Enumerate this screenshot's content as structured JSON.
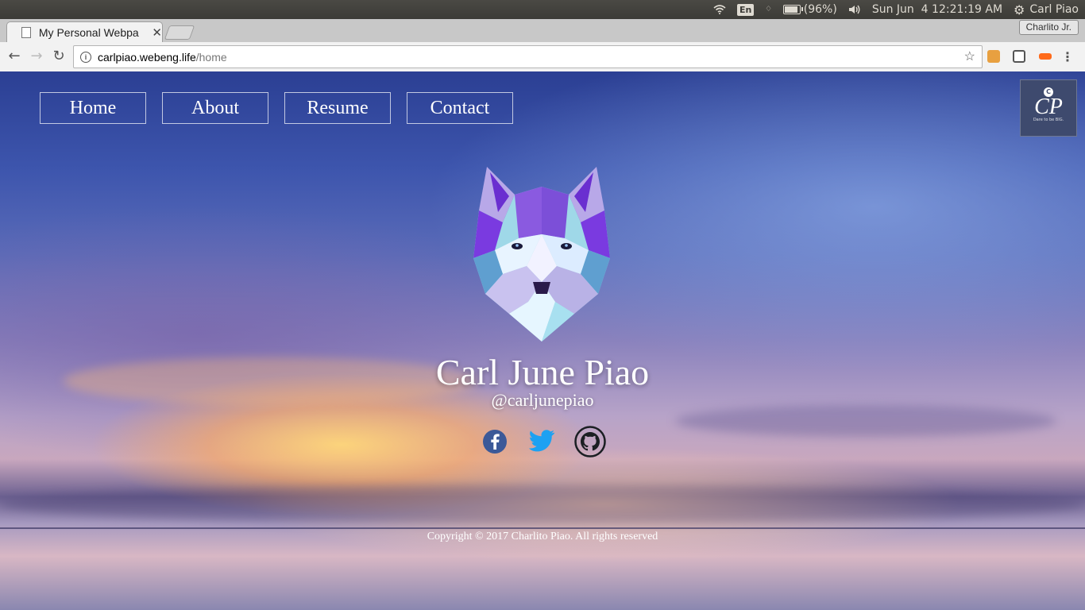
{
  "os_panel": {
    "lang": "En",
    "battery": "(96%)",
    "battery_level_percent": 96,
    "clock": "Sun Jun  4 12:21:19 AM",
    "user": "Carl Piao"
  },
  "browser": {
    "tab_title": "My Personal Webpa",
    "profile_name": "Charlito Jr.",
    "url_host": "carlpiao.webeng.life",
    "url_path": "/home"
  },
  "page": {
    "nav": [
      {
        "label": "Home"
      },
      {
        "label": "About"
      },
      {
        "label": "Resume"
      },
      {
        "label": "Contact"
      }
    ],
    "logo": {
      "badge": "C",
      "monogram": "CP",
      "tagline": "Dare to be BIG."
    },
    "name": "Carl June Piao",
    "handle": "@carljunepiao",
    "social": [
      "facebook-icon",
      "twitter-icon",
      "github-icon"
    ],
    "footer": "Copyright © 2017 Charlito Piao. All rights reserved"
  },
  "colors": {
    "facebook": "#3b5998",
    "twitter": "#1da1f2",
    "github": "#1b1f23"
  }
}
